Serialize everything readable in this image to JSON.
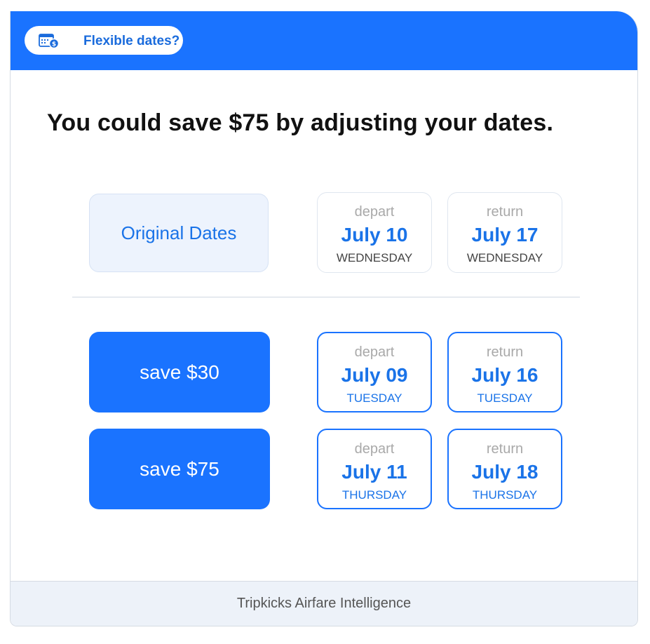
{
  "header": {
    "pill_label": "Flexible dates?",
    "pill_icon": "calendar-dollar-icon",
    "accent": "#1a73ff"
  },
  "headline": "You could save $75 by adjusting your dates.",
  "original": {
    "label": "Original Dates",
    "depart": {
      "kind": "depart",
      "date": "July 10",
      "day": "WEDNESDAY"
    },
    "return": {
      "kind": "return",
      "date": "July 17",
      "day": "WEDNESDAY"
    }
  },
  "options": [
    {
      "save_label": "save $30",
      "depart": {
        "kind": "depart",
        "date": "July 09",
        "day": "TUESDAY"
      },
      "return": {
        "kind": "return",
        "date": "July 16",
        "day": "TUESDAY"
      }
    },
    {
      "save_label": "save $75",
      "depart": {
        "kind": "depart",
        "date": "July 11",
        "day": "THURSDAY"
      },
      "return": {
        "kind": "return",
        "date": "July 18",
        "day": "THURSDAY"
      }
    }
  ],
  "footer": "Tripkicks Airfare Intelligence"
}
